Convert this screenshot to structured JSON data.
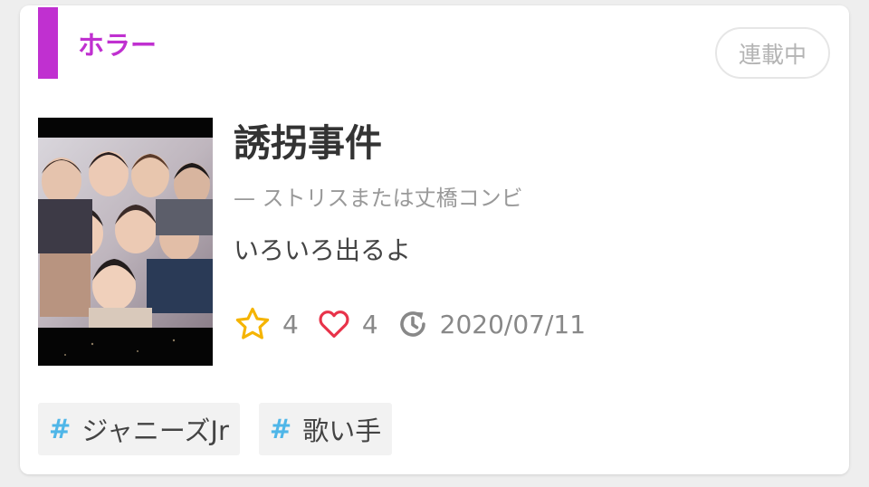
{
  "genre": {
    "label": "ホラー",
    "color": "#c030d0"
  },
  "status": {
    "label": "連載中"
  },
  "novel": {
    "title": "誘拐事件",
    "author": "— ストリスまたは丈橋コンビ",
    "description": "いろいろ出るよ",
    "thumbnail_icon": "cover-photo"
  },
  "stats": {
    "stars": "4",
    "hearts": "4",
    "updated": "2020/07/11",
    "star_icon": "star-icon",
    "heart_icon": "heart-icon",
    "update_icon": "clock-refresh-icon",
    "star_color": "#f5b400",
    "heart_color": "#e8334a"
  },
  "tags": [
    {
      "hash": "#",
      "label": "ジャニーズJr"
    },
    {
      "hash": "#",
      "label": "歌い手"
    }
  ]
}
